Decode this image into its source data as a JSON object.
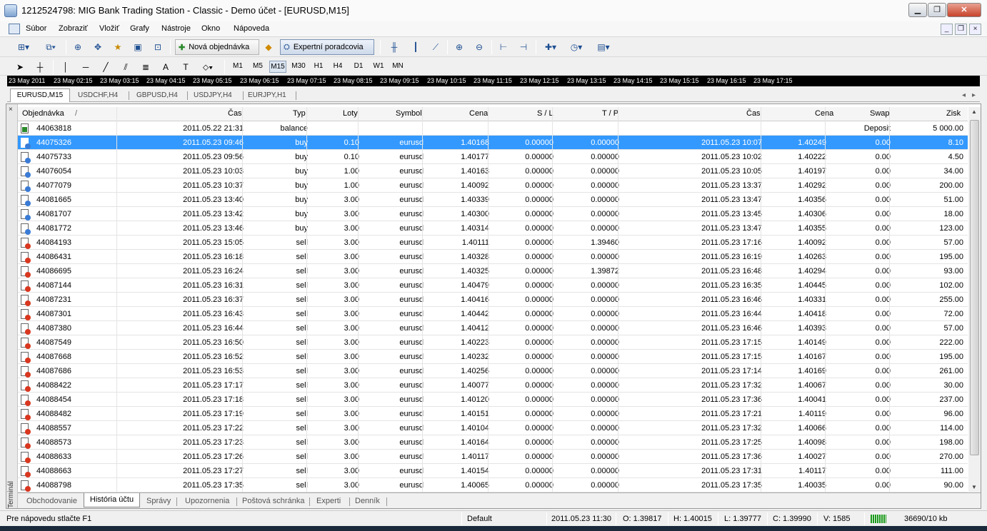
{
  "window": {
    "title": "1212524798: MIG Bank Trading Station - Classic - Demo účet - [EURUSD,M15]"
  },
  "menu": [
    "Súbor",
    "Zobraziť",
    "Vložiť",
    "Grafy",
    "Nástroje",
    "Okno",
    "Nápoveda"
  ],
  "toolbar": {
    "new_order": "Nová objednávka",
    "experts": "Expertní poradcovia"
  },
  "timeframes": [
    "M1",
    "M5",
    "M15",
    "M30",
    "H1",
    "H4",
    "D1",
    "W1",
    "MN"
  ],
  "timeline": [
    "23 May 2011",
    "23 May 02:15",
    "23 May 03:15",
    "23 May 04:15",
    "23 May 05:15",
    "23 May 06:15",
    "23 May 07:15",
    "23 May 08:15",
    "23 May 09:15",
    "23 May 10:15",
    "23 May 11:15",
    "23 May 12:15",
    "23 May 13:15",
    "23 May 14:15",
    "23 May 15:15",
    "23 May 16:15",
    "23 May 17:15"
  ],
  "chart_tabs": [
    "EURUSD,M15",
    "USDCHF,H4",
    "GBPUSD,H4",
    "USDJPY,H4",
    "EURJPY,H1"
  ],
  "columns": [
    "Objednávka",
    "/",
    "Čas",
    "Typ",
    "Loty",
    "Symbol",
    "Cena",
    "S / L",
    "T / P",
    "Čas",
    "Cena",
    "Swap",
    "Zisk"
  ],
  "balance_row": {
    "order": "44063818",
    "time": "2011.05.22 21:31",
    "type": "balance",
    "comment": "Deposit",
    "profit": "5 000.00"
  },
  "rows": [
    [
      "44075326",
      "2011.05.23 09:46",
      "buy",
      "0.10",
      "eurusd",
      "1.40168",
      "0.00000",
      "0.00000",
      "2011.05.23 10:07",
      "1.40249",
      "0.00",
      "8.10"
    ],
    [
      "44075733",
      "2011.05.23 09:56",
      "buy",
      "0.10",
      "eurusd",
      "1.40177",
      "0.00000",
      "0.00000",
      "2011.05.23 10:02",
      "1.40222",
      "0.00",
      "4.50"
    ],
    [
      "44076054",
      "2011.05.23 10:03",
      "buy",
      "1.00",
      "eurusd",
      "1.40163",
      "0.00000",
      "0.00000",
      "2011.05.23 10:05",
      "1.40197",
      "0.00",
      "34.00"
    ],
    [
      "44077079",
      "2011.05.23 10:37",
      "buy",
      "1.00",
      "eurusd",
      "1.40092",
      "0.00000",
      "0.00000",
      "2011.05.23 13:37",
      "1.40292",
      "0.00",
      "200.00"
    ],
    [
      "44081665",
      "2011.05.23 13:40",
      "buy",
      "3.00",
      "eurusd",
      "1.40339",
      "0.00000",
      "0.00000",
      "2011.05.23 13:47",
      "1.40356",
      "0.00",
      "51.00"
    ],
    [
      "44081707",
      "2011.05.23 13:42",
      "buy",
      "3.00",
      "eurusd",
      "1.40300",
      "0.00000",
      "0.00000",
      "2011.05.23 13:45",
      "1.40306",
      "0.00",
      "18.00"
    ],
    [
      "44081772",
      "2011.05.23 13:46",
      "buy",
      "3.00",
      "eurusd",
      "1.40314",
      "0.00000",
      "0.00000",
      "2011.05.23 13:47",
      "1.40355",
      "0.00",
      "123.00"
    ],
    [
      "44084193",
      "2011.05.23 15:05",
      "sell",
      "3.00",
      "eurusd",
      "1.40111",
      "0.00000",
      "1.39460",
      "2011.05.23 17:16",
      "1.40092",
      "0.00",
      "57.00"
    ],
    [
      "44086431",
      "2011.05.23 16:18",
      "sell",
      "3.00",
      "eurusd",
      "1.40328",
      "0.00000",
      "0.00000",
      "2011.05.23 16:19",
      "1.40263",
      "0.00",
      "195.00"
    ],
    [
      "44086695",
      "2011.05.23 16:24",
      "sell",
      "3.00",
      "eurusd",
      "1.40325",
      "0.00000",
      "1.39872",
      "2011.05.23 16:48",
      "1.40294",
      "0.00",
      "93.00"
    ],
    [
      "44087144",
      "2011.05.23 16:31",
      "sell",
      "3.00",
      "eurusd",
      "1.40479",
      "0.00000",
      "0.00000",
      "2011.05.23 16:35",
      "1.40445",
      "0.00",
      "102.00"
    ],
    [
      "44087231",
      "2011.05.23 16:37",
      "sell",
      "3.00",
      "eurusd",
      "1.40416",
      "0.00000",
      "0.00000",
      "2011.05.23 16:46",
      "1.40331",
      "0.00",
      "255.00"
    ],
    [
      "44087301",
      "2011.05.23 16:43",
      "sell",
      "3.00",
      "eurusd",
      "1.40442",
      "0.00000",
      "0.00000",
      "2011.05.23 16:44",
      "1.40418",
      "0.00",
      "72.00"
    ],
    [
      "44087380",
      "2011.05.23 16:44",
      "sell",
      "3.00",
      "eurusd",
      "1.40412",
      "0.00000",
      "0.00000",
      "2011.05.23 16:46",
      "1.40393",
      "0.00",
      "57.00"
    ],
    [
      "44087549",
      "2011.05.23 16:50",
      "sell",
      "3.00",
      "eurusd",
      "1.40223",
      "0.00000",
      "0.00000",
      "2011.05.23 17:15",
      "1.40149",
      "0.00",
      "222.00"
    ],
    [
      "44087668",
      "2011.05.23 16:52",
      "sell",
      "3.00",
      "eurusd",
      "1.40232",
      "0.00000",
      "0.00000",
      "2011.05.23 17:15",
      "1.40167",
      "0.00",
      "195.00"
    ],
    [
      "44087686",
      "2011.05.23 16:53",
      "sell",
      "3.00",
      "eurusd",
      "1.40256",
      "0.00000",
      "0.00000",
      "2011.05.23 17:14",
      "1.40169",
      "0.00",
      "261.00"
    ],
    [
      "44088422",
      "2011.05.23 17:17",
      "sell",
      "3.00",
      "eurusd",
      "1.40077",
      "0.00000",
      "0.00000",
      "2011.05.23 17:32",
      "1.40067",
      "0.00",
      "30.00"
    ],
    [
      "44088454",
      "2011.05.23 17:18",
      "sell",
      "3.00",
      "eurusd",
      "1.40120",
      "0.00000",
      "0.00000",
      "2011.05.23 17:36",
      "1.40041",
      "0.00",
      "237.00"
    ],
    [
      "44088482",
      "2011.05.23 17:19",
      "sell",
      "3.00",
      "eurusd",
      "1.40151",
      "0.00000",
      "0.00000",
      "2011.05.23 17:21",
      "1.40119",
      "0.00",
      "96.00"
    ],
    [
      "44088557",
      "2011.05.23 17:22",
      "sell",
      "3.00",
      "eurusd",
      "1.40104",
      "0.00000",
      "0.00000",
      "2011.05.23 17:32",
      "1.40066",
      "0.00",
      "114.00"
    ],
    [
      "44088573",
      "2011.05.23 17:23",
      "sell",
      "3.00",
      "eurusd",
      "1.40164",
      "0.00000",
      "0.00000",
      "2011.05.23 17:25",
      "1.40098",
      "0.00",
      "198.00"
    ],
    [
      "44088633",
      "2011.05.23 17:26",
      "sell",
      "3.00",
      "eurusd",
      "1.40117",
      "0.00000",
      "0.00000",
      "2011.05.23 17:36",
      "1.40027",
      "0.00",
      "270.00"
    ],
    [
      "44088663",
      "2011.05.23 17:27",
      "sell",
      "3.00",
      "eurusd",
      "1.40154",
      "0.00000",
      "0.00000",
      "2011.05.23 17:31",
      "1.40117",
      "0.00",
      "111.00"
    ],
    [
      "44088798",
      "2011.05.23 17:35",
      "sell",
      "3.00",
      "eurusd",
      "1.40065",
      "0.00000",
      "0.00000",
      "2011.05.23 17:35",
      "1.40035",
      "0.00",
      "90.00"
    ]
  ],
  "selected_row": 0,
  "terminal_label": "Terminál",
  "terminal_tabs": [
    "Obchodovanie",
    "História účtu",
    "Správy",
    "Upozornenia",
    "Poštová schránka",
    "Experti",
    "Denník"
  ],
  "active_terminal_tab": 1,
  "status": {
    "help": "Pre nápovedu stlačte F1",
    "profile": "Default",
    "datetime": "2011.05.23 11:30",
    "open": "O: 1.39817",
    "high": "H: 1.40015",
    "low": "L: 1.39777",
    "close": "C: 1.39990",
    "volume": "V: 1585",
    "traffic": "36690/10 kb"
  },
  "colors": {
    "selection": "#3399ff",
    "buy_icon": "#3a7bd5",
    "sell_icon": "#d9371f"
  }
}
